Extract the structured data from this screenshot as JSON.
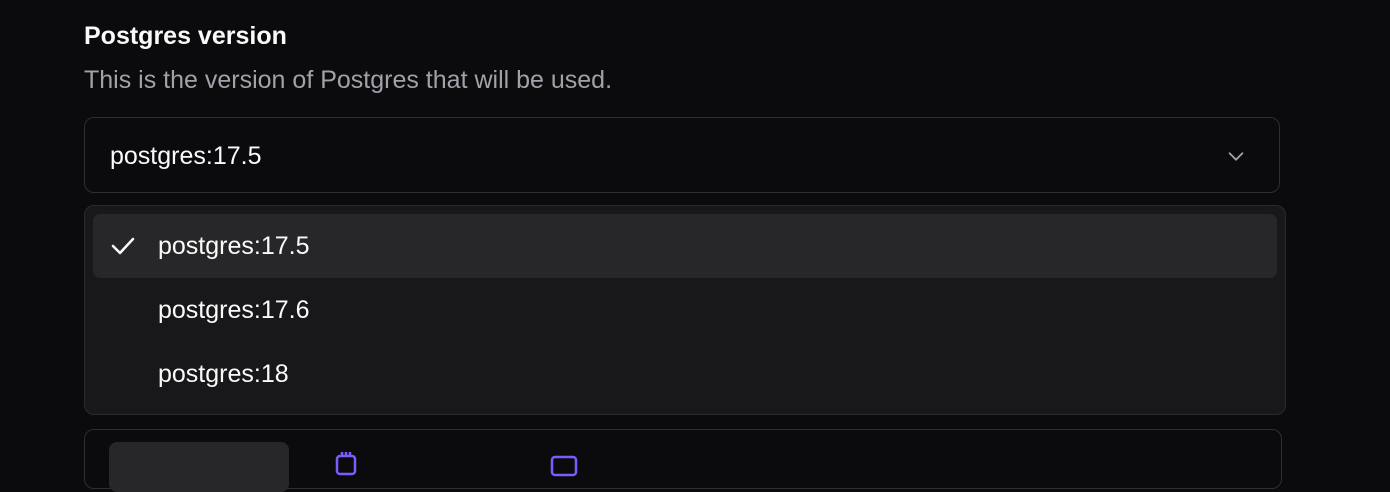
{
  "field": {
    "label": "Postgres version",
    "description": "This is the version of Postgres that will be used.",
    "selected_value": "postgres:17.5"
  },
  "dropdown": {
    "options": [
      {
        "label": "postgres:17.5",
        "selected": true
      },
      {
        "label": "postgres:17.6",
        "selected": false
      },
      {
        "label": "postgres:18",
        "selected": false
      }
    ]
  },
  "bottom": {
    "button_label": "",
    "cpu": "",
    "ram": "",
    "price": ""
  },
  "colors": {
    "background": "#0b0b0d",
    "popover": "#18181b",
    "highlight": "#27272a",
    "muted_text": "#a1a1aa",
    "icon_accent": "#7c5cff"
  },
  "icons": {
    "chevron": "chevron-down-icon",
    "check": "check-icon",
    "cpu": "cpu-icon",
    "ram": "memory-icon"
  }
}
